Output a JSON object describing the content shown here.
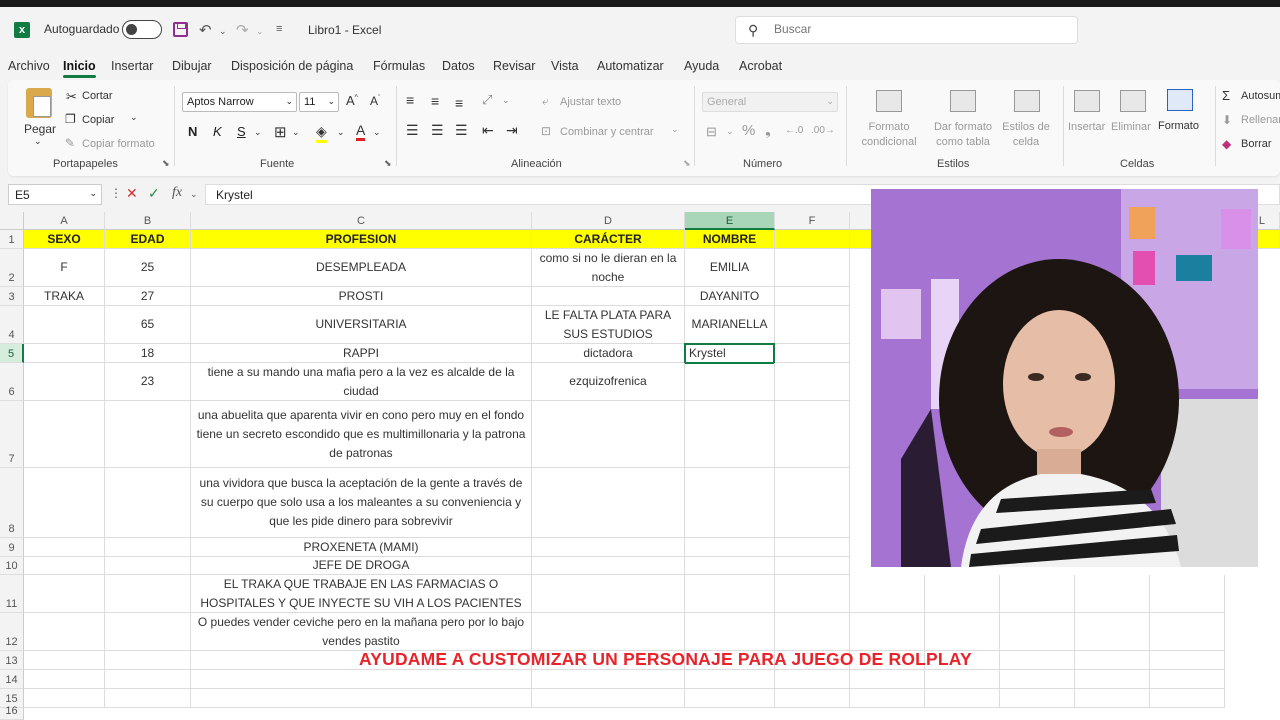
{
  "app": {
    "autosave_label": "Autoguardado",
    "doc_title": "Libro1  -  Excel",
    "search_placeholder": "Buscar",
    "brand_color": "#107c41"
  },
  "menu": [
    "Archivo",
    "Inicio",
    "Insertar",
    "Dibujar",
    "Disposición de página",
    "Fórmulas",
    "Datos",
    "Revisar",
    "Vista",
    "Automatizar",
    "Ayuda",
    "Acrobat"
  ],
  "ribbon": {
    "clipboard": {
      "paste": "Pegar",
      "cut": "Cortar",
      "copy": "Copiar",
      "format_painter": "Copiar formato",
      "label": "Portapapeles"
    },
    "font": {
      "name": "Aptos Narrow",
      "size": "11",
      "bold": "N",
      "italic": "K",
      "underline": "S",
      "label": "Fuente"
    },
    "alignment": {
      "wrap": "Ajustar texto",
      "merge": "Combinar y centrar",
      "label": "Alineación"
    },
    "number": {
      "format": "General",
      "label": "Número"
    },
    "styles": {
      "conditional": "Formato condicional",
      "as_table": "Dar formato como tabla",
      "cell_styles": "Estilos de celda",
      "label": "Estilos"
    },
    "cells": {
      "insert": "Insertar",
      "delete": "Eliminar",
      "format": "Formato",
      "label": "Celdas"
    },
    "editing": {
      "autosum": "Autosuma",
      "fill": "Rellenar",
      "clear": "Borrar"
    }
  },
  "formula_bar": {
    "cell_ref": "E5",
    "fx": "fx",
    "value": "Krystel"
  },
  "columns": [
    "A",
    "B",
    "C",
    "D",
    "E",
    "F",
    "L"
  ],
  "rows": [
    "1",
    "2",
    "3",
    "4",
    "5",
    "6",
    "7",
    "8",
    "9",
    "10",
    "11",
    "12",
    "13",
    "14",
    "15",
    "16"
  ],
  "headers": {
    "a": "SEXO",
    "b": "EDAD",
    "c": "PROFESION",
    "d": "CARÁCTER",
    "e": "NOMBRE"
  },
  "cells": {
    "a2": "F",
    "b2": "25",
    "c2": "DESEMPLEADA",
    "d2": "como si no le dieran en la noche",
    "e2": "EMILIA",
    "a3": "TRAKA",
    "b3": "27",
    "c3": "PROSTI",
    "e3": "DAYANITO",
    "b4": "65",
    "c4": "UNIVERSITARIA",
    "d4": "LE FALTA PLATA PARA SUS ESTUDIOS",
    "e4": "MARIANELLA",
    "b5": "18",
    "c5": "RAPPI",
    "d5": "dictadora",
    "e5": "Krystel",
    "b6": "23",
    "c6": "tiene a su mando una mafia pero a la vez es alcalde de la ciudad",
    "d6": "ezquizofrenica",
    "c7": "una abuelita que aparenta vivir en cono pero muy en el fondo tiene un secreto escondido que es multimillonaria y la patrona de patronas",
    "c8": "una vividora que busca la aceptación de la gente a través de su cuerpo que solo usa a los maleantes a su conveniencia y que les pide dinero para sobrevivir",
    "c9": "PROXENETA (MAMI)",
    "c10": "JEFE DE DROGA",
    "c11": "EL TRAKA QUE TRABAJE EN LAS FARMACIAS O HOSPITALES Y QUE INYECTE SU VIH A LOS PACIENTES",
    "c12": "O puedes vender ceviche pero en la mañana pero por lo bajo vendes pastito"
  },
  "overlay_caption": "AYUDAME A CUSTOMIZAR UN PERSONAJE PARA JUEGO DE ROLPLAY"
}
